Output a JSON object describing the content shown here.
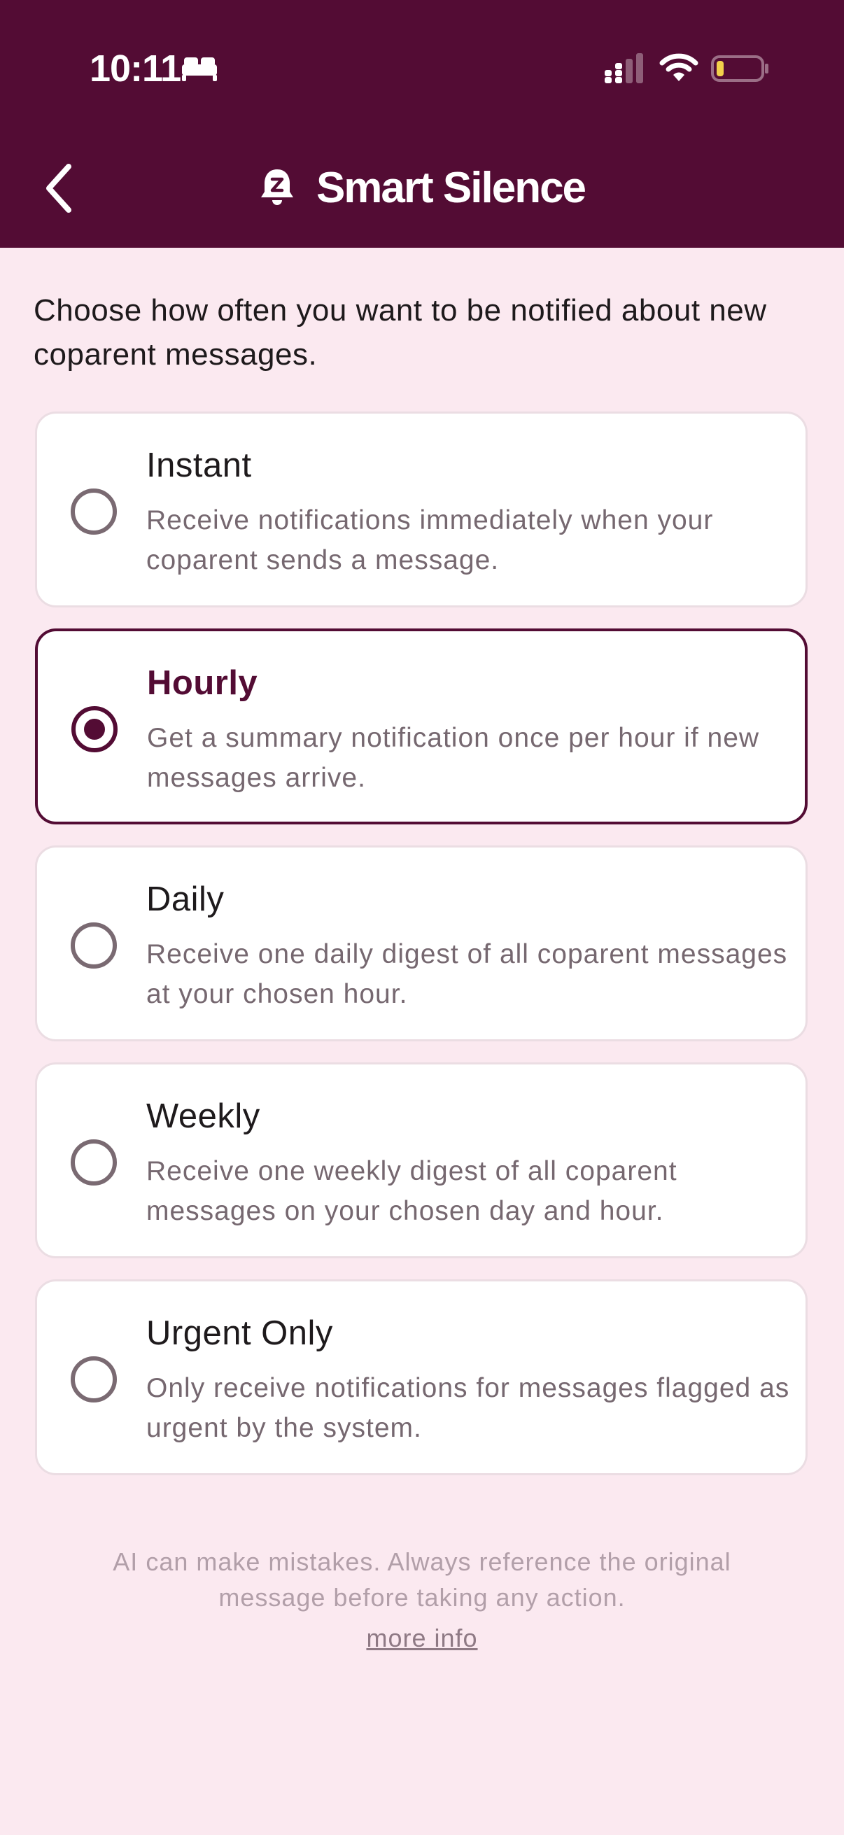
{
  "status_bar": {
    "time": "10:11",
    "icons": [
      "bed-icon",
      "cellular-signal-icon",
      "wifi-icon",
      "battery-low-icon"
    ]
  },
  "header": {
    "back_icon": "chevron-left-icon",
    "title_icon": "bell-snooze-icon",
    "title": "Smart Silence"
  },
  "intro_text": "Choose how often you want to be notified about new coparent messages.",
  "options": [
    {
      "title": "Instant",
      "description": "Receive notifications immediately when your coparent sends a message.",
      "selected": false
    },
    {
      "title": "Hourly",
      "description": "Get a summary notification once per hour if new messages arrive.",
      "selected": true
    },
    {
      "title": "Daily",
      "description": "Receive one daily digest of all coparent messages at your chosen hour.",
      "selected": false
    },
    {
      "title": "Weekly",
      "description": "Receive one weekly digest of all coparent messages on your chosen day and hour.",
      "selected": false
    },
    {
      "title": "Urgent Only",
      "description": "Only receive notifications for messages flagged as urgent by the system.",
      "selected": false
    }
  ],
  "footer": {
    "disclaimer": "AI can make mistakes. Always reference the original message before taking any action.",
    "more_info_link": "more info"
  },
  "colors": {
    "brand": "#530C34",
    "background": "#FBE9F0",
    "card": "#FFFFFF",
    "battery_level": "#F2D04B"
  }
}
